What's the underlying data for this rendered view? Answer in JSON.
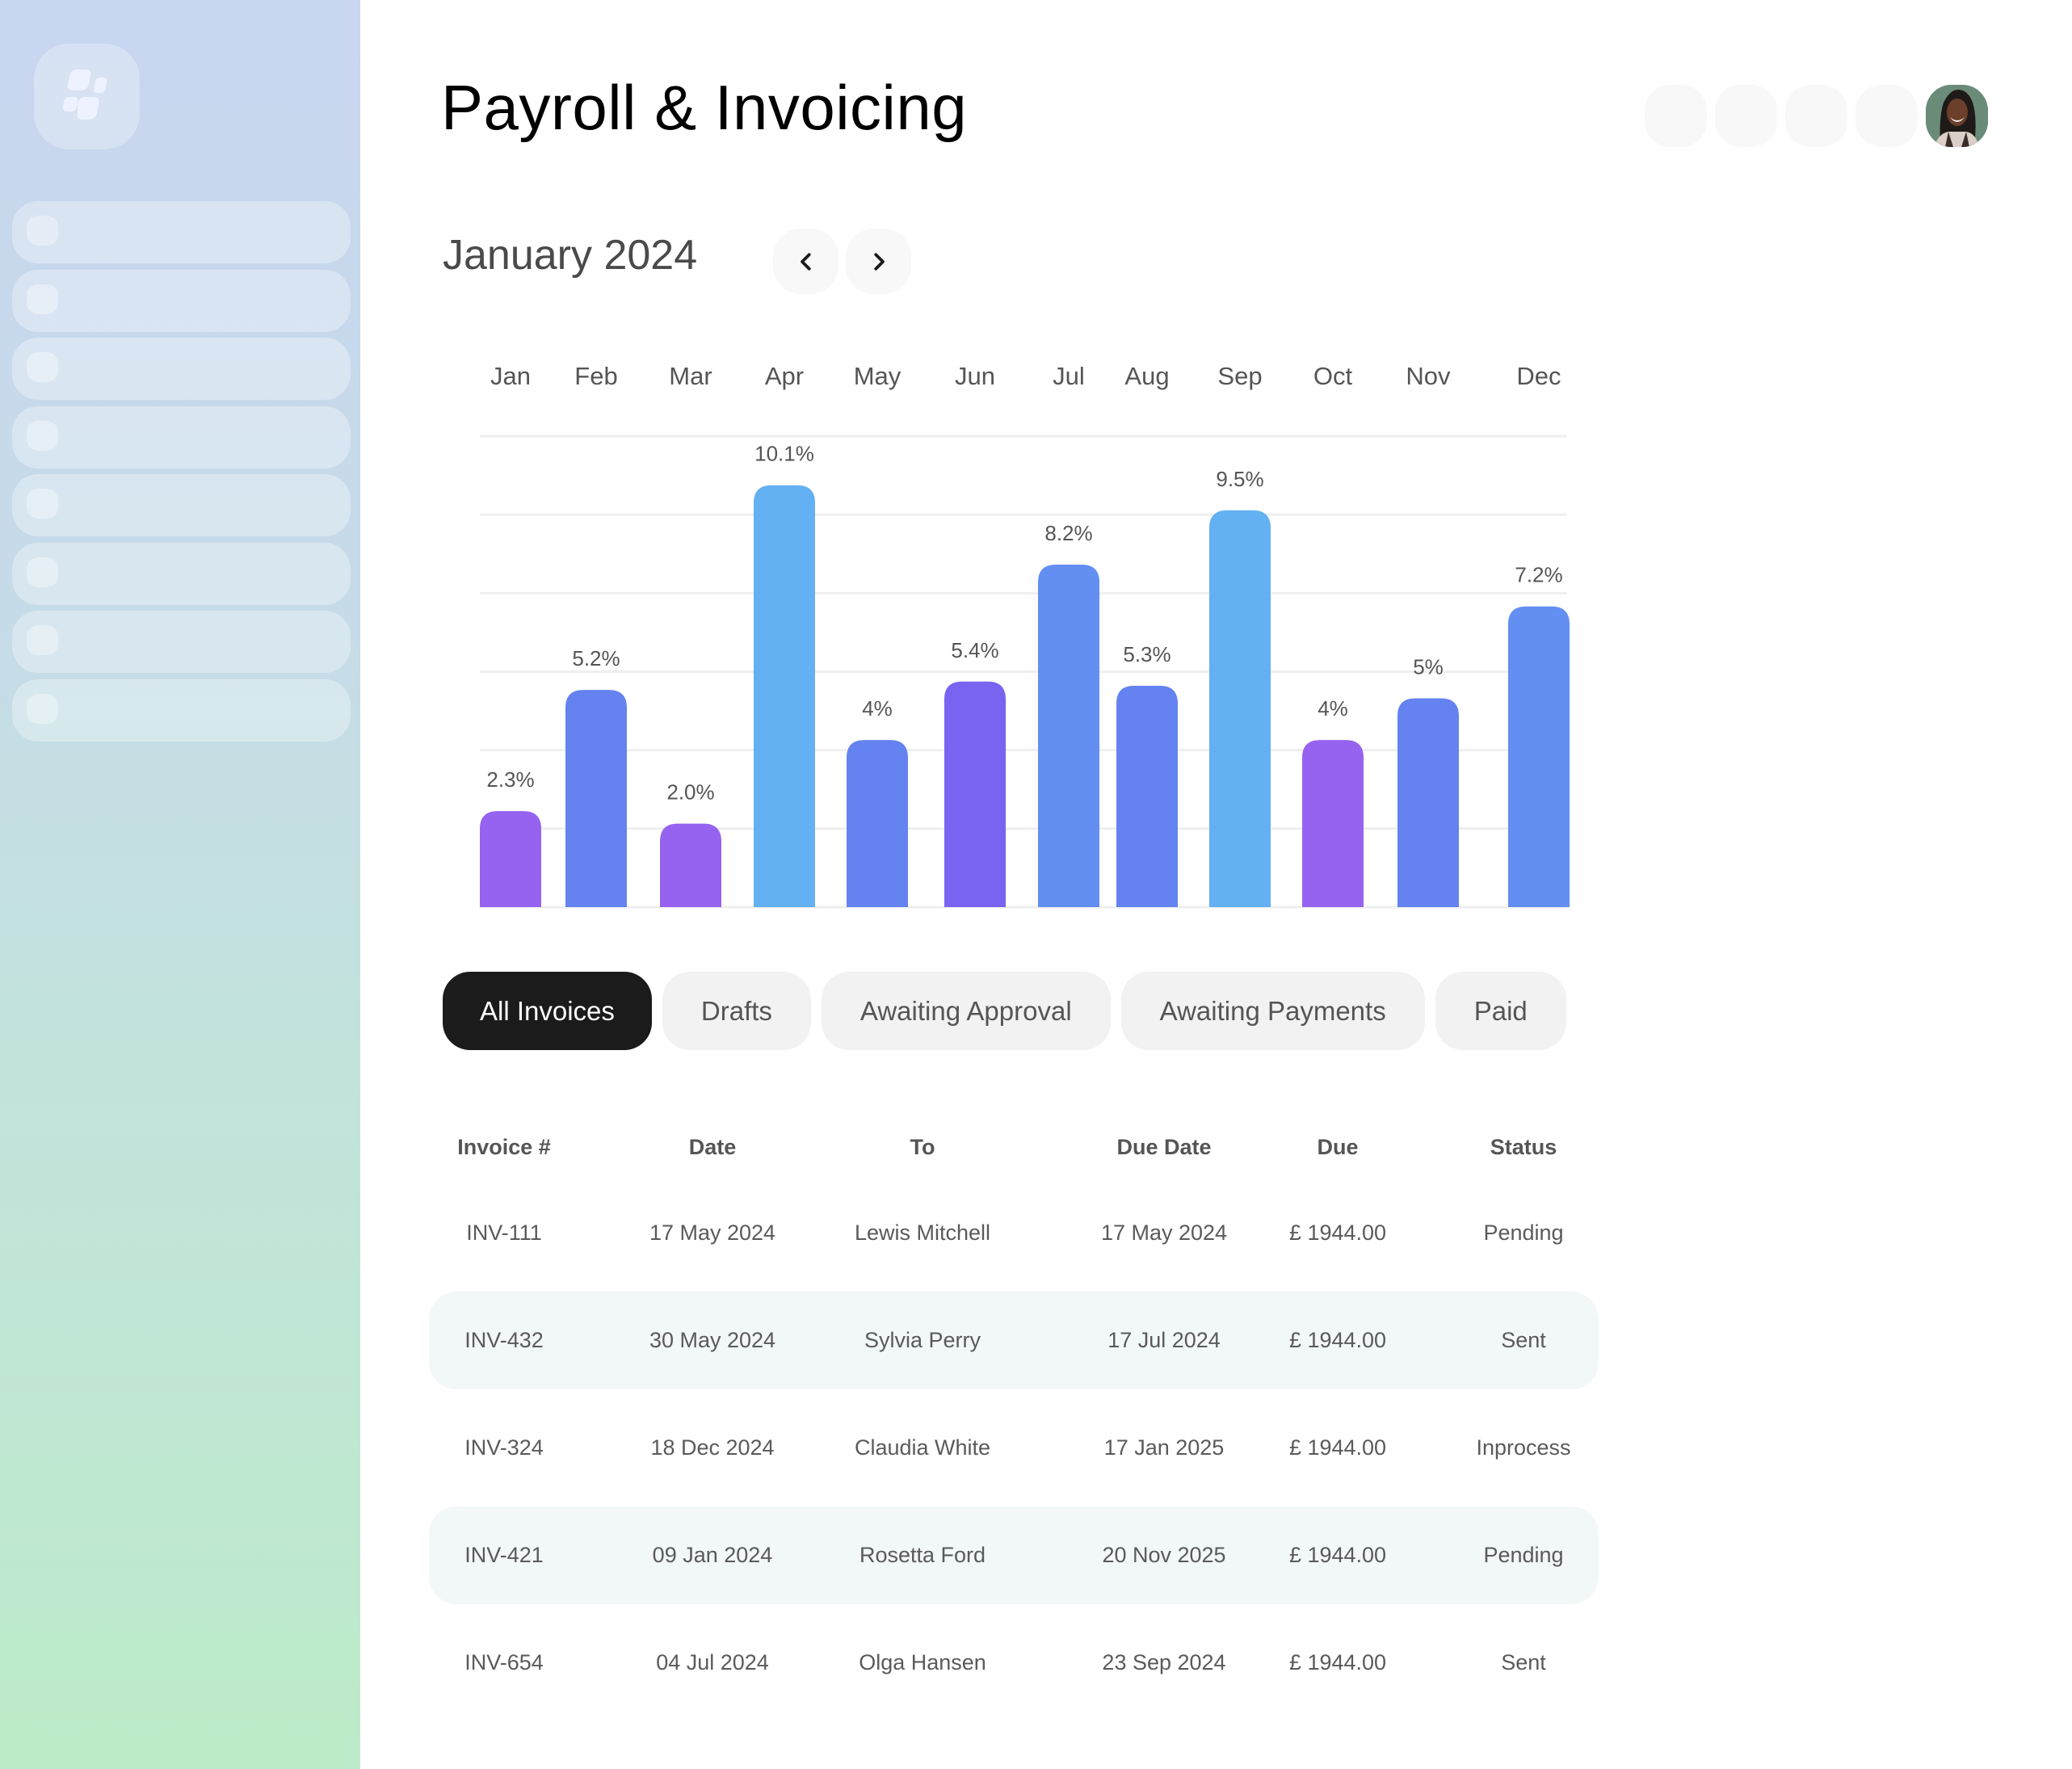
{
  "app": {
    "title": "Payroll & Invoicing"
  },
  "sidebar": {
    "logo_icon": "app-logo-icon",
    "items": [
      {
        "label": "",
        "icon": "placeholder-icon"
      },
      {
        "label": "",
        "icon": "placeholder-icon"
      },
      {
        "label": "",
        "icon": "placeholder-icon"
      },
      {
        "label": "",
        "icon": "placeholder-icon"
      },
      {
        "label": "",
        "icon": "placeholder-icon"
      },
      {
        "label": "",
        "icon": "placeholder-icon"
      },
      {
        "label": "",
        "icon": "placeholder-icon"
      },
      {
        "label": "",
        "icon": "placeholder-icon"
      }
    ],
    "gradient": {
      "top": "#c8d6f0",
      "bottom": "#bdebc9"
    }
  },
  "header": {
    "action_buttons": [
      {
        "icon": "placeholder-icon"
      },
      {
        "icon": "placeholder-icon"
      },
      {
        "icon": "placeholder-icon"
      },
      {
        "icon": "placeholder-icon"
      }
    ],
    "avatar": {
      "icon": "user-avatar"
    }
  },
  "period": {
    "label": "January 2024",
    "prev_icon": "chevron-left-icon",
    "next_icon": "chevron-right-icon"
  },
  "chart_data": {
    "type": "bar",
    "title": "",
    "xlabel": "",
    "ylabel": "",
    "categories": [
      "Jan",
      "Feb",
      "Mar",
      "Apr",
      "May",
      "Jun",
      "Jul",
      "Aug",
      "Sep",
      "Oct",
      "Nov",
      "Dec"
    ],
    "values": [
      2.3,
      5.2,
      2.0,
      10.1,
      4,
      5.4,
      8.2,
      5.3,
      9.5,
      4,
      5,
      7.2
    ],
    "value_labels": [
      "2.3%",
      "5.2%",
      "2.0%",
      "10.1%",
      "4%",
      "5.4%",
      "8.2%",
      "5.3%",
      "9.5%",
      "4%",
      "5%",
      "7.2%"
    ],
    "bar_colors": [
      "#9663f0",
      "#6483f0",
      "#9663f0",
      "#63b0f2",
      "#6483f0",
      "#7864f0",
      "#638ef2",
      "#6483f0",
      "#63b0f2",
      "#9663f0",
      "#6483f0",
      "#638ef2"
    ],
    "ylim": [
      0,
      11.5
    ],
    "grid": true,
    "gridline_count": 7,
    "legend": "none",
    "category_position": "top"
  },
  "tabs": [
    {
      "label": "All Invoices",
      "active": true
    },
    {
      "label": "Drafts",
      "active": false
    },
    {
      "label": "Awaiting Approval",
      "active": false
    },
    {
      "label": "Awaiting Payments",
      "active": false
    },
    {
      "label": "Paid",
      "active": false
    }
  ],
  "table": {
    "columns": [
      "Invoice #",
      "Date",
      "To",
      "Due Date",
      "Due",
      "Status"
    ],
    "rows": [
      [
        "INV-111",
        "17 May 2024",
        "Lewis Mitchell",
        "17 May 2024",
        "£ 1944.00",
        "Pending"
      ],
      [
        "INV-432",
        "30 May 2024",
        "Sylvia Perry",
        "17 Jul 2024",
        "£ 1944.00",
        "Sent"
      ],
      [
        "INV-324",
        "18 Dec 2024",
        "Claudia White",
        "17 Jan 2025",
        "£ 1944.00",
        "Inprocess"
      ],
      [
        "INV-421",
        "09 Jan 2024",
        "Rosetta Ford",
        "20 Nov 2025",
        "£ 1944.00",
        "Pending"
      ],
      [
        "INV-654",
        "04 Jul 2024",
        "Olga Hansen",
        "23 Sep 2024",
        "£ 1944.00",
        "Sent"
      ]
    ]
  }
}
